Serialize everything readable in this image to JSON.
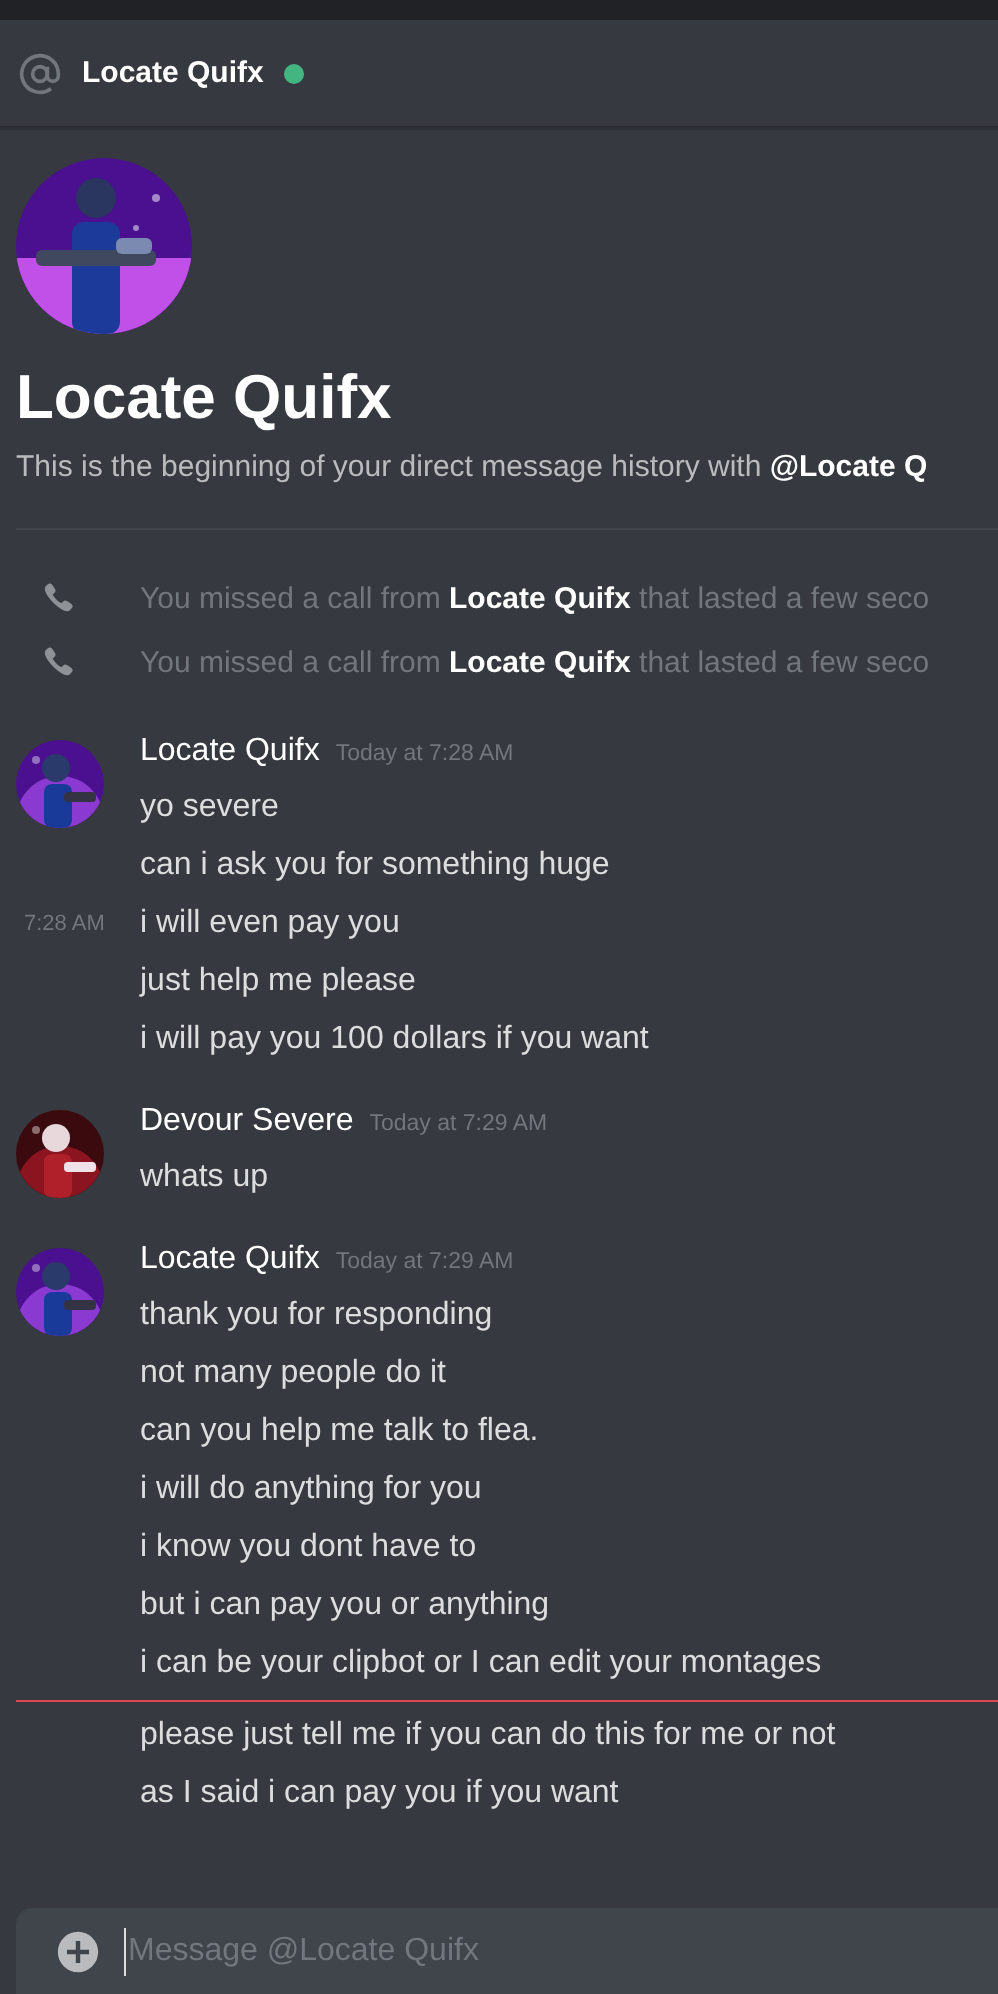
{
  "header": {
    "title": "Locate Quifx",
    "online": true
  },
  "intro": {
    "name": "Locate Quifx",
    "description": "This is the beginning of your direct message history with **@Locate Q**"
  },
  "calls": [
    {
      "text": "You missed a call from **Locate Quifx** that lasted a few seco"
    },
    {
      "text": "You missed a call from **Locate Quifx** that lasted a few seco"
    }
  ],
  "groups": [
    {
      "author": "Locate Quifx",
      "time": "Today at 7:28 AM",
      "avatar": {
        "kind": "picture",
        "color": "#8a3ad0"
      },
      "lines": [
        {
          "text": "yo severe",
          "new_divider_before": false
        },
        {
          "text": "can i ask you for something huge",
          "new_divider_before": false
        },
        {
          "text": "i will even pay you",
          "hover_time": "7:28 AM",
          "new_divider_before": false
        },
        {
          "text": "just help me please",
          "new_divider_before": false
        },
        {
          "text": "i will pay you 100 dollars if you want",
          "new_divider_before": false
        }
      ]
    },
    {
      "author": "Devour Severe",
      "time": "Today at 7:29 AM",
      "avatar": {
        "kind": "picture",
        "color": "#8a1420"
      },
      "lines": [
        {
          "text": "whats up",
          "new_divider_before": false
        }
      ]
    },
    {
      "author": "Locate Quifx",
      "time": "Today at 7:29 AM",
      "avatar": {
        "kind": "picture",
        "color": "#8a3ad0"
      },
      "lines": [
        {
          "text": "thank you for responding",
          "new_divider_before": false
        },
        {
          "text": "not many people do it",
          "new_divider_before": false
        },
        {
          "text": "can you help me talk to flea.",
          "new_divider_before": false
        },
        {
          "text": "i will do anything for you",
          "new_divider_before": false
        },
        {
          "text": "i know you dont have to",
          "new_divider_before": false
        },
        {
          "text": "but i can pay you or anything",
          "new_divider_before": false
        },
        {
          "text": "i can be your clipbot or I can edit your montages",
          "new_divider_before": false
        },
        {
          "text": "please just tell me if you can do this for me or not",
          "new_divider_before": true
        },
        {
          "text": "as I said i can pay you if you want",
          "new_divider_before": false
        }
      ]
    }
  ],
  "composer": {
    "placeholder": "Message @Locate Quifx"
  }
}
